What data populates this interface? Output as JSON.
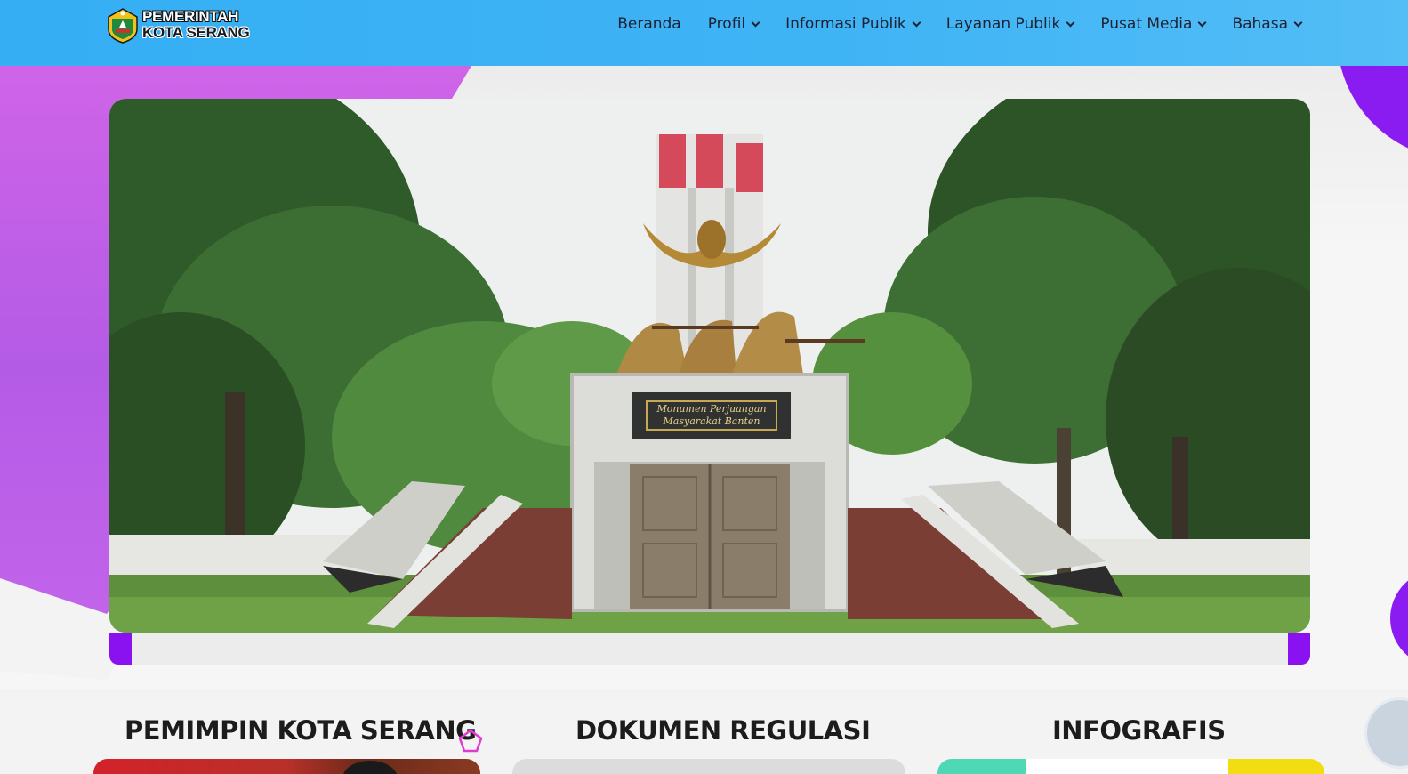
{
  "header": {
    "logo": {
      "line1": "PEMERINTAH",
      "line2": "KOTA SERANG"
    },
    "nav": [
      {
        "label": "Beranda",
        "dropdown": false
      },
      {
        "label": "Profil",
        "dropdown": true
      },
      {
        "label": "Informasi Publik",
        "dropdown": true
      },
      {
        "label": "Layanan Publik",
        "dropdown": true
      },
      {
        "label": "Pusat Media",
        "dropdown": true
      },
      {
        "label": "Bahasa",
        "dropdown": true
      }
    ]
  },
  "hero": {
    "plaque_line1": "Monumen Perjuangan",
    "plaque_line2": "Masyarakat Banten"
  },
  "sections": {
    "leaders": "PEMIMPIN KOTA SERANG",
    "regulations": "DOKUMEN REGULASI",
    "infographics": "INFOGRAFIS"
  },
  "colors": {
    "header": "#3fb4f5",
    "accent": "#8a12f0",
    "background_shape": "#c264ea"
  },
  "icons": [
    "chevron-down-icon",
    "slider-prev-icon",
    "slider-next-icon",
    "pentagon-decoration-icon"
  ]
}
